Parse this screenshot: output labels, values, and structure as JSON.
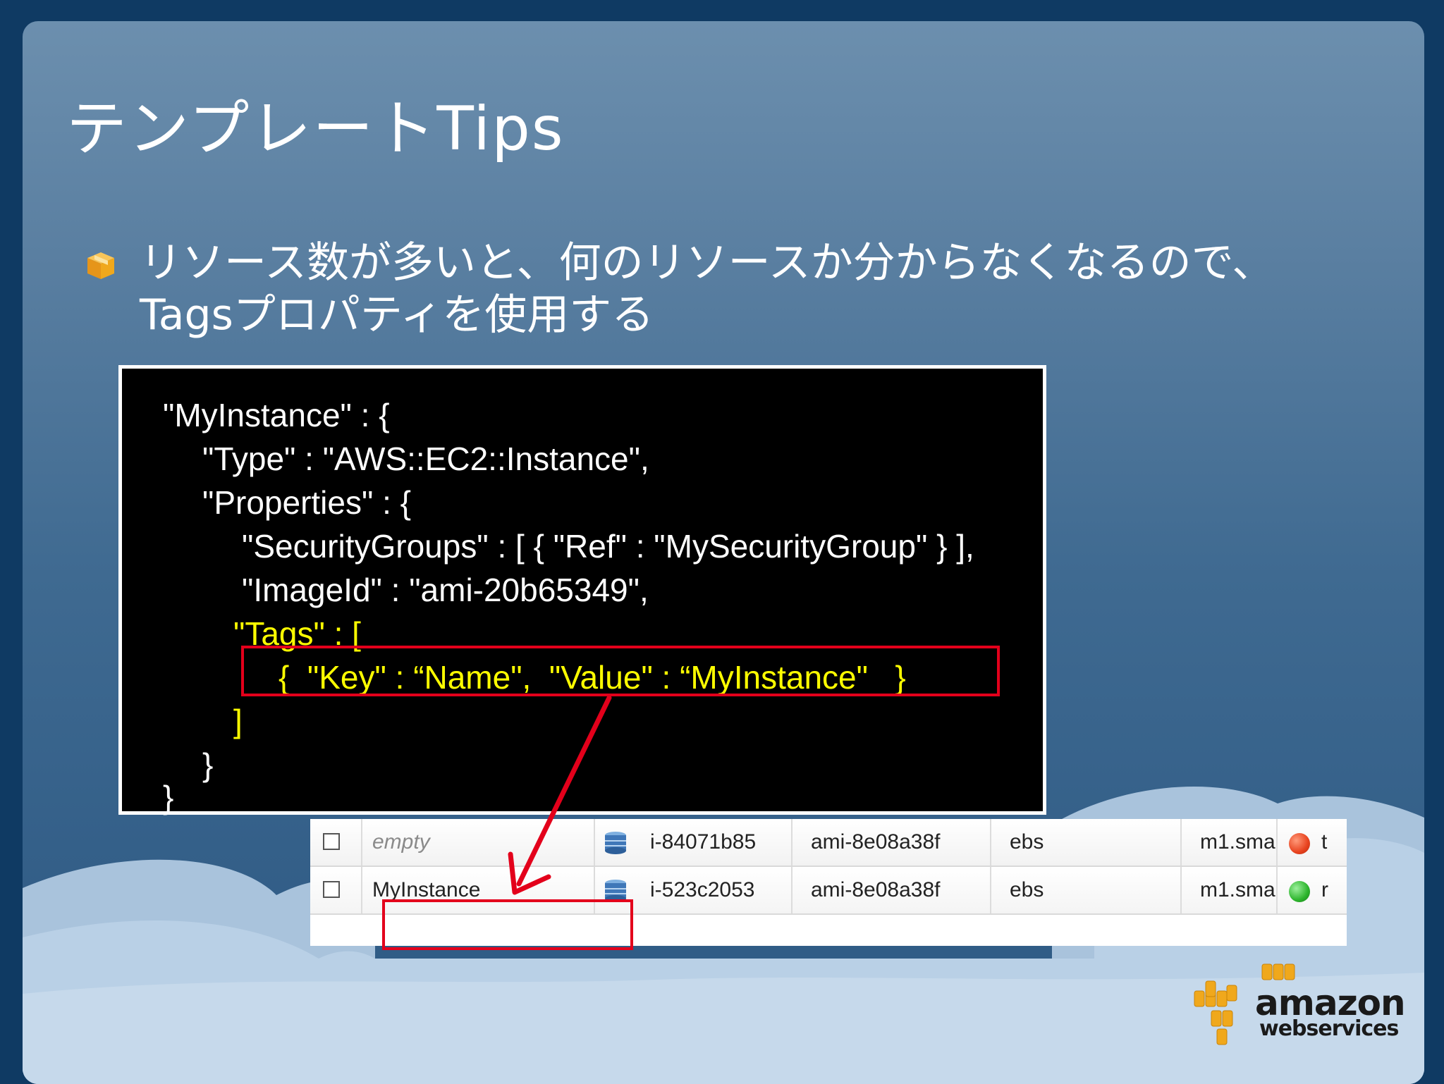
{
  "slide": {
    "title": "テンプレートTips",
    "bullet": "リソース数が多いと、何のリソースか分からなくなるので、Tagsプロパティを使用する",
    "colors": {
      "accent_red": "#e3001b",
      "code_yellow": "#ffff00",
      "bullet_orange": "#f0a81c"
    }
  },
  "code": {
    "lines": [
      "\"MyInstance\" : {",
      "\"Type\" : \"AWS::EC2::Instance\",",
      "\"Properties\" : {",
      "\"SecurityGroups\" : [ { \"Ref\" : \"MySecurityGroup\" } ],",
      "\"ImageId\" : \"ami-20b65349\",",
      "\"Tags\" : [",
      "{  \"Key\" : “Name\",  \"Value\" : “MyInstance\"   }",
      "]",
      "}",
      "}"
    ]
  },
  "table": {
    "rows": [
      {
        "name": "empty",
        "instance_id": "i-84071b85",
        "ami": "ami-8e08a38f",
        "root_device": "ebs",
        "type": "m1.sma",
        "status_color": "#e8431f",
        "state": "t"
      },
      {
        "name": "MyInstance",
        "instance_id": "i-523c2053",
        "ami": "ami-8e08a38f",
        "root_device": "ebs",
        "type": "m1.sma",
        "status_color": "#2db52d",
        "state": "r"
      }
    ]
  },
  "logo": {
    "brand": "amazon",
    "sub": "webservices"
  },
  "icons": {
    "bullet": "box-icon",
    "instance": "database-icon",
    "arrow": "red-arrow"
  }
}
